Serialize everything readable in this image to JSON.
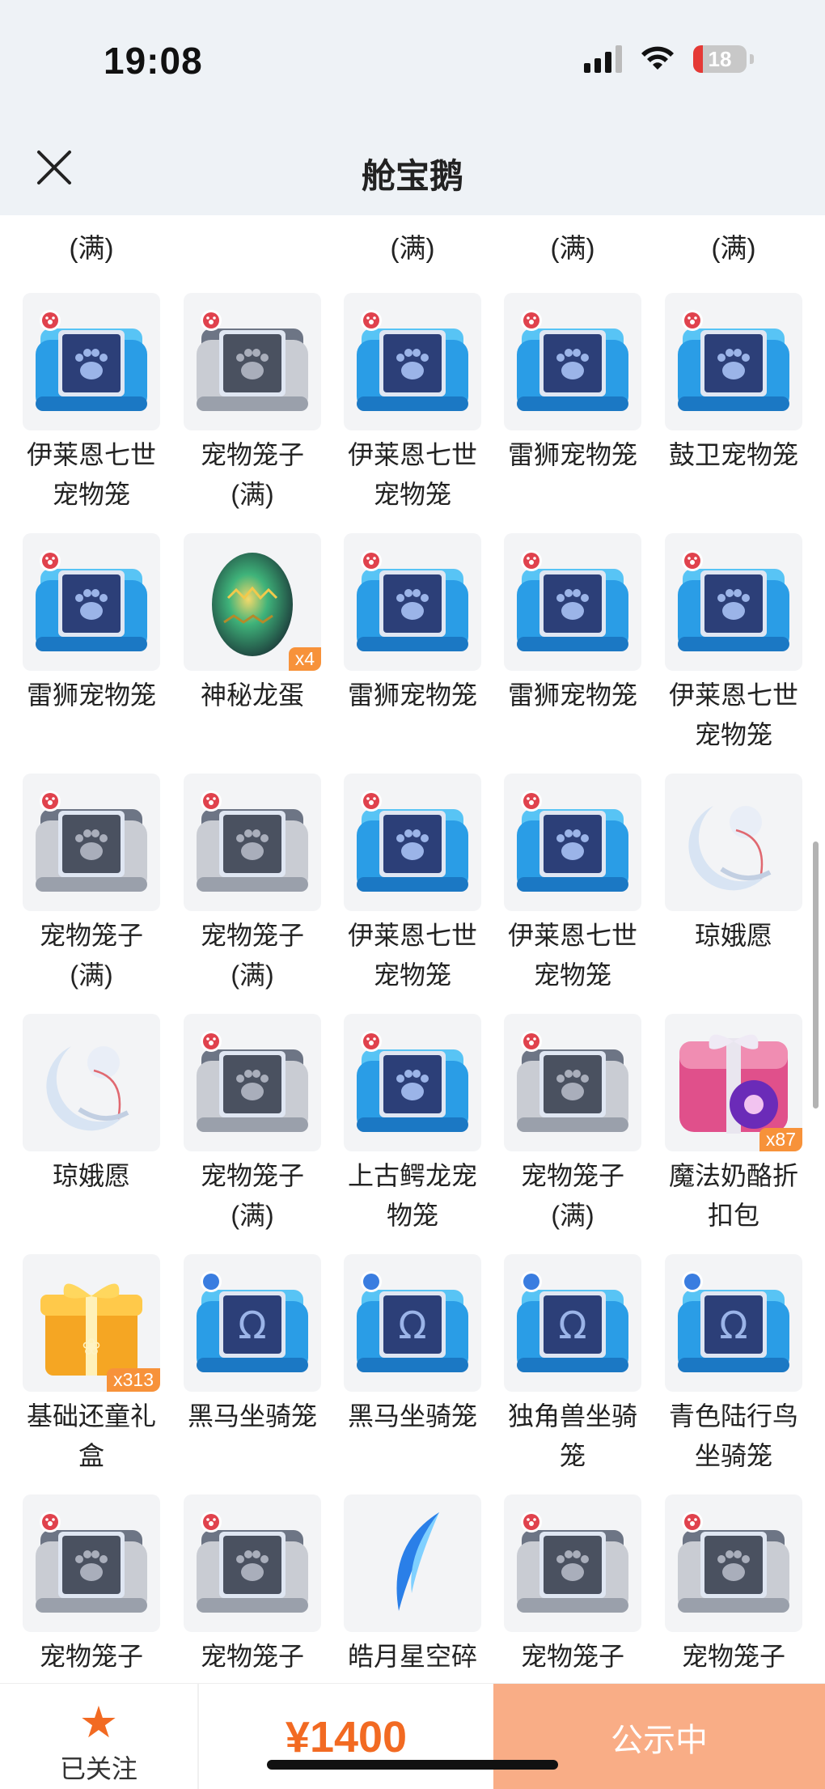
{
  "status": {
    "time": "19:08",
    "battery": "18"
  },
  "header": {
    "title": "舱宝鹅"
  },
  "peek_labels": [
    "(满)",
    "",
    "(满)",
    "(满)",
    "(满)"
  ],
  "rows": [
    [
      {
        "type": "cage-blue",
        "l1": "伊莱恩七世",
        "l2": "宠物笼"
      },
      {
        "type": "cage-gray",
        "l1": "宠物笼子",
        "l2": "(满)"
      },
      {
        "type": "cage-blue",
        "l1": "伊莱恩七世",
        "l2": "宠物笼"
      },
      {
        "type": "cage-blue",
        "l1": "雷狮宠物笼",
        "l2": ""
      },
      {
        "type": "cage-blue",
        "l1": "鼓卫宠物笼",
        "l2": ""
      }
    ],
    [
      {
        "type": "cage-blue",
        "l1": "雷狮宠物笼",
        "l2": ""
      },
      {
        "type": "egg",
        "l1": "神秘龙蛋",
        "l2": "",
        "qty": "x4"
      },
      {
        "type": "cage-blue",
        "l1": "雷狮宠物笼",
        "l2": ""
      },
      {
        "type": "cage-blue",
        "l1": "雷狮宠物笼",
        "l2": ""
      },
      {
        "type": "cage-blue",
        "l1": "伊莱恩七世",
        "l2": "宠物笼"
      }
    ],
    [
      {
        "type": "cage-gray",
        "l1": "宠物笼子",
        "l2": "(满)"
      },
      {
        "type": "cage-gray",
        "l1": "宠物笼子",
        "l2": "(满)"
      },
      {
        "type": "cage-blue",
        "l1": "伊莱恩七世",
        "l2": "宠物笼"
      },
      {
        "type": "cage-blue",
        "l1": "伊莱恩七世",
        "l2": "宠物笼"
      },
      {
        "type": "moon",
        "l1": "琼娥愿",
        "l2": ""
      }
    ],
    [
      {
        "type": "moon",
        "l1": "琼娥愿",
        "l2": ""
      },
      {
        "type": "cage-gray",
        "l1": "宠物笼子",
        "l2": "(满)"
      },
      {
        "type": "cage-blue",
        "l1": "上古鳄龙宠",
        "l2": "物笼"
      },
      {
        "type": "cage-gray",
        "l1": "宠物笼子",
        "l2": "(满)"
      },
      {
        "type": "giftpink",
        "l1": "魔法奶酪折",
        "l2": "扣包",
        "qty": "x87"
      }
    ],
    [
      {
        "type": "giftgold",
        "l1": "基础还童礼",
        "l2": "盒",
        "qty": "x313"
      },
      {
        "type": "mount",
        "l1": "黑马坐骑笼",
        "l2": ""
      },
      {
        "type": "mount",
        "l1": "黑马坐骑笼",
        "l2": ""
      },
      {
        "type": "mount",
        "l1": "独角兽坐骑",
        "l2": "笼"
      },
      {
        "type": "mount",
        "l1": "青色陆行鸟",
        "l2": "坐骑笼"
      }
    ],
    [
      {
        "type": "cage-gray",
        "l1": "宠物笼子",
        "l2": ""
      },
      {
        "type": "cage-gray",
        "l1": "宠物笼子",
        "l2": ""
      },
      {
        "type": "shard",
        "l1": "皓月星空碎",
        "l2": ""
      },
      {
        "type": "cage-gray",
        "l1": "宠物笼子",
        "l2": ""
      },
      {
        "type": "cage-gray",
        "l1": "宠物笼子",
        "l2": ""
      }
    ]
  ],
  "bottom": {
    "follow_label": "已关注",
    "price": "¥1400",
    "public_label": "公示中"
  },
  "colors": {
    "accent": "#f26a22",
    "button": "#f9ad86",
    "header_bg": "#eef2f6"
  }
}
